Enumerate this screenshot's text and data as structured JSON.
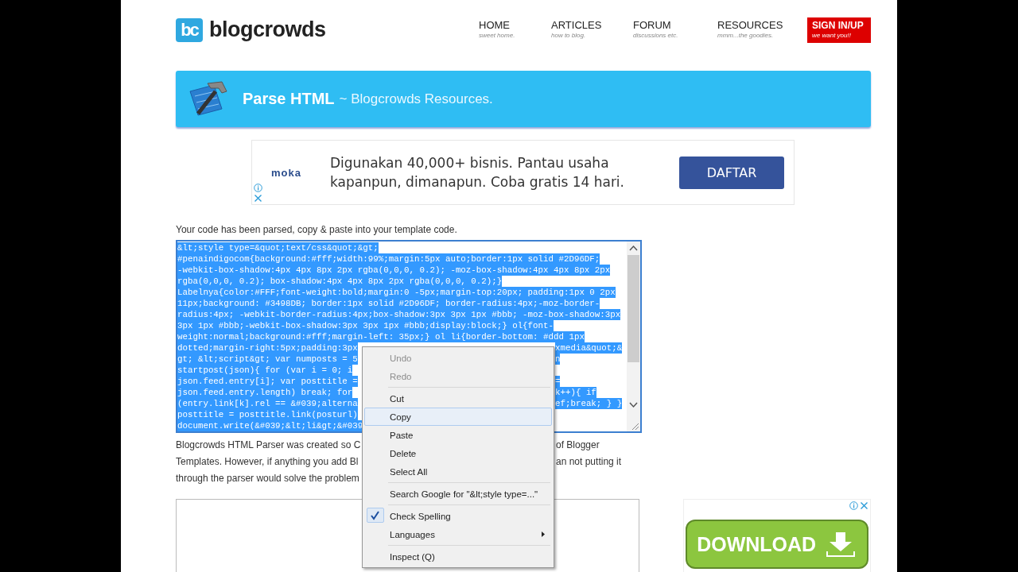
{
  "header": {
    "logo": {
      "mark": "bc",
      "name": "blogcrowds"
    },
    "nav": [
      {
        "label": "HOME",
        "sub": "sweet home."
      },
      {
        "label": "ARTICLES",
        "sub": "how to blog."
      },
      {
        "label": "FORUM",
        "sub": "discussions etc."
      },
      {
        "label": "RESOURCES",
        "sub": "mmm...the goodies."
      }
    ],
    "sign_in": {
      "label": "SIGN IN/UP",
      "sub": "we want you!!"
    }
  },
  "banner": {
    "title": "Parse HTML",
    "subtitle": "~ Blogcrowds Resources."
  },
  "ad_top": {
    "brand": "moka",
    "lines": [
      "Digunakan 40,000+ bisnis. Pantau usaha",
      "kapanpun, dimanapun. Coba gratis 14 hari."
    ],
    "button": "DAFTAR"
  },
  "notice": "Your code has been parsed, copy & paste into your template code.",
  "code_box": {
    "lines": [
      {
        "left": "&lt;style type=&quot;text/css&quot;&gt;"
      },
      {
        "left": "#penaindigocom{background:#fff;width:99%;margin:5px auto;border:1px solid #2D96DF;"
      },
      {
        "left": "-webkit-box-shadow:4px 4px 8px 2px rgba(0,0,0, 0.2); -moz-box-shadow:4px 4px 8px 2px"
      },
      {
        "left": "rgba(0,0,0, 0.2); box-shadow:4px 4px 8px 2px rgba(0,0,0, 0.2);}"
      },
      {
        "left": "Labelnya{color:#FFF;font-weight:bold;margin:0 -5px;margin-top:20px; padding:1px 0 2px"
      },
      {
        "left": "11px;background: #3498DB; border:1px solid #2D96DF; border-radius:4px;-moz-border-"
      },
      {
        "left": "radius:4px; -webkit-border-radius:4px;box-shadow:3px 3px 1px #bbb; -moz-box-shadow:3px"
      },
      {
        "left": "3px 1px #bbb;-webkit-box-shadow:3px 3px 1px #bbb;display:block;} ol{font-"
      },
      {
        "left": "weight:normal;background:#fff;margin-left: 35px;} ol li{border-bottom: #ddd 1px"
      },
      {
        "left": "dotted;margin-right:5px;padding:3px",
        "right": "xmedia&quot;&"
      },
      {
        "left": "gt; &lt;script&gt; var numposts = 5",
        "right": "n"
      },
      {
        "left": "startpost(json){ for (var i = 0; i"
      },
      {
        "left": "json.feed.entry[i]; var posttitle =",
        "right": "="
      },
      {
        "left": "json.feed.entry.length) break; for",
        "right": "k++){ if"
      },
      {
        "left": "(entry.link[k].rel == &#039;alterna",
        "right": "ef;break; } }"
      },
      {
        "left": "posttitle = posttitle.link(posturl)"
      },
      {
        "left": "document.write(&#039;&lt;li&gt;&#039"
      }
    ]
  },
  "description": {
    "lines": [
      {
        "left": "Blogcrowds HTML Parser was created so C",
        "right": "of Blogger"
      },
      {
        "left": "Templates. However, if anything you add Bl",
        "right": "an not putting it"
      },
      {
        "left": "through the parser would solve the problem"
      }
    ]
  },
  "context_menu": {
    "items": [
      {
        "kind": "item",
        "label": "Undo",
        "disabled": true,
        "selected": false,
        "checked": false
      },
      {
        "kind": "item",
        "label": "Redo",
        "disabled": true,
        "selected": false,
        "checked": false
      },
      {
        "kind": "separator"
      },
      {
        "kind": "item",
        "label": "Cut",
        "disabled": false,
        "selected": false,
        "checked": false
      },
      {
        "kind": "item",
        "label": "Copy",
        "disabled": false,
        "selected": true,
        "checked": false
      },
      {
        "kind": "item",
        "label": "Paste",
        "disabled": false,
        "selected": false,
        "checked": false
      },
      {
        "kind": "item",
        "label": "Delete",
        "disabled": false,
        "selected": false,
        "checked": false
      },
      {
        "kind": "item",
        "label": "Select All",
        "disabled": false,
        "selected": false,
        "checked": false
      },
      {
        "kind": "separator"
      },
      {
        "kind": "item",
        "label": "Search Google for \"&lt;style type=...\"",
        "disabled": false,
        "selected": false,
        "checked": false
      },
      {
        "kind": "separator"
      },
      {
        "kind": "item",
        "label": "Check Spelling",
        "disabled": false,
        "selected": false,
        "checked": true
      },
      {
        "kind": "submenu",
        "label": "Languages",
        "disabled": false,
        "selected": false,
        "checked": false
      },
      {
        "kind": "separator"
      },
      {
        "kind": "item",
        "label": "Inspect (Q)",
        "disabled": false,
        "selected": false,
        "checked": false
      }
    ]
  },
  "ad_bottom": {
    "button": "DOWNLOAD"
  }
}
